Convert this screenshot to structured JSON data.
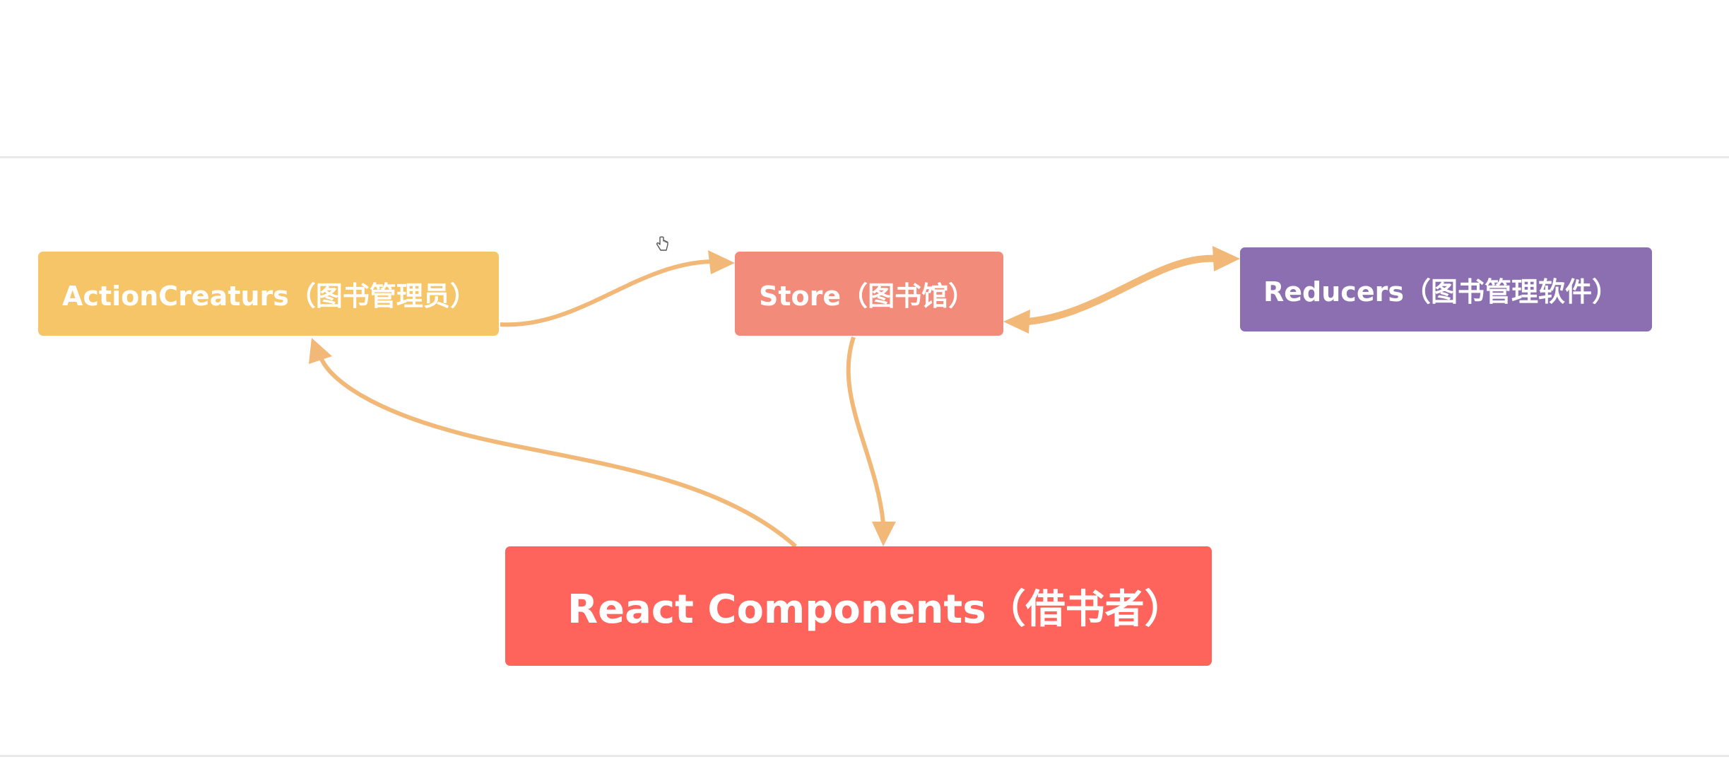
{
  "diagram": {
    "nodes": {
      "action_creators": {
        "label": "ActionCreaturs（图书管理员）",
        "color": "#f6c567"
      },
      "store": {
        "label": "Store（图书馆）",
        "color": "#f28b7a"
      },
      "reducers": {
        "label": "Reducers（图书管理软件）",
        "color": "#8b6fb0"
      },
      "react_components": {
        "label": "React Components（借书者）",
        "color": "#fe645c"
      }
    },
    "arrow_color": "#f2b877",
    "edges": [
      {
        "from": "action_creators",
        "to": "store"
      },
      {
        "from": "store",
        "to": "reducers"
      },
      {
        "from": "reducers",
        "to": "store"
      },
      {
        "from": "store",
        "to": "react_components"
      },
      {
        "from": "react_components",
        "to": "action_creators"
      }
    ]
  },
  "icons": {
    "cursor": "hand-pointer-icon"
  },
  "colors": {
    "background": "#ffffff",
    "divider": "#e9e9e9"
  }
}
